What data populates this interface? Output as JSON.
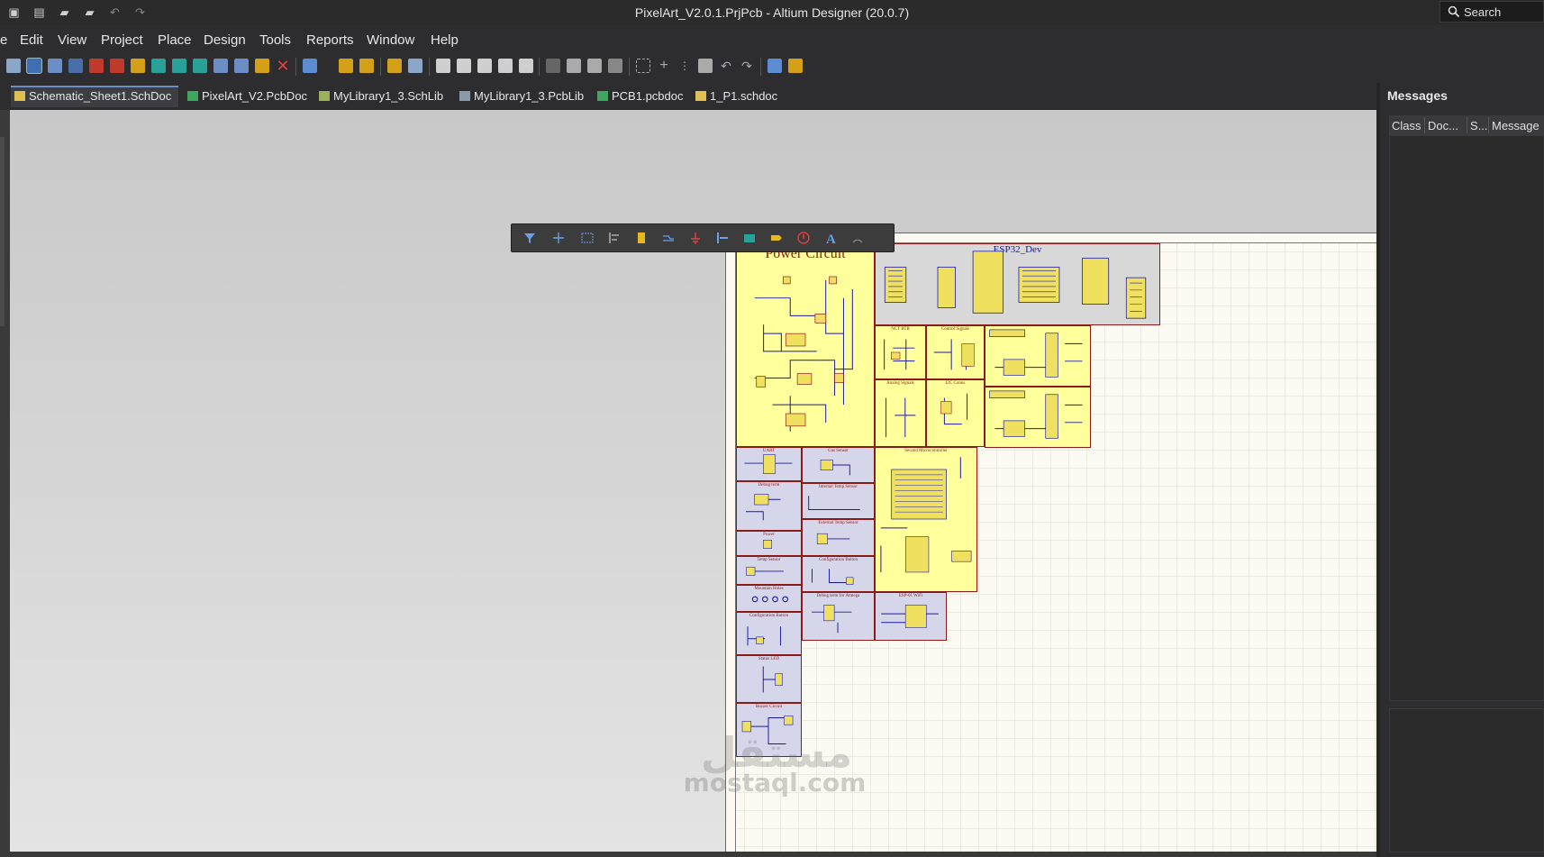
{
  "window": {
    "title": "PixelArt_V2.0.1.PrjPcb - Altium Designer (20.0.7)",
    "search_label": "Search"
  },
  "menu": {
    "items": [
      {
        "label": "e"
      },
      {
        "label": "Edit"
      },
      {
        "label": "View"
      },
      {
        "label": "Project"
      },
      {
        "label": "Place"
      },
      {
        "label": "Design"
      },
      {
        "label": "Tools"
      },
      {
        "label": "Reports"
      },
      {
        "label": "Window"
      },
      {
        "label": "Help"
      }
    ]
  },
  "tabs": [
    {
      "label": "Schematic_Sheet1.SchDoc",
      "icon": "schdoc-icon",
      "active": true
    },
    {
      "label": "PixelArt_V2.PcbDoc",
      "icon": "pcbdoc-icon"
    },
    {
      "label": "MyLibrary1_3.SchLib",
      "icon": "schlib-icon"
    },
    {
      "label": "MyLibrary1_3.PcbLib",
      "icon": "pcblib-icon"
    },
    {
      "label": "PCB1.pcbdoc",
      "icon": "pcbdoc-icon"
    },
    {
      "label": "1_P1.schdoc",
      "icon": "folder-icon"
    }
  ],
  "messages_panel": {
    "title": "Messages",
    "columns": [
      "Class",
      "Doc...",
      "S...",
      "Message"
    ]
  },
  "schematic": {
    "sheets": [
      {
        "id": "power",
        "title": "Power Circuit"
      },
      {
        "id": "esp32",
        "title": "ESP32_Dev"
      },
      {
        "id": "nct",
        "title": "NCT RTR"
      },
      {
        "id": "control",
        "title": "Control Signals"
      },
      {
        "id": "analog",
        "title": "Analog Signals"
      },
      {
        "id": "i2c",
        "title": "I2C Conns"
      },
      {
        "id": "uart",
        "title": "UART"
      },
      {
        "id": "gas",
        "title": "Gas Sensor"
      },
      {
        "id": "debug",
        "title": "Debug term"
      },
      {
        "id": "internal_temp",
        "title": "Internal Temp Sensor"
      },
      {
        "id": "second_mcu",
        "title": "Second Microcontroller"
      },
      {
        "id": "power_small",
        "title": "Power"
      },
      {
        "id": "external_temp",
        "title": "External Temp Sensor"
      },
      {
        "id": "temp",
        "title": "Temp Sensor"
      },
      {
        "id": "config_btn",
        "title": "Configuration Button"
      },
      {
        "id": "mounting",
        "title": "Mountain Holes"
      },
      {
        "id": "debug_atmega",
        "title": "Debug term for Atmega"
      },
      {
        "id": "esp01",
        "title": "ESP-01 WiFi"
      },
      {
        "id": "config_btn2",
        "title": "Configuration Button"
      },
      {
        "id": "status_led",
        "title": "Status LED"
      },
      {
        "id": "buzzer",
        "title": "Buzzer Circuit"
      }
    ]
  },
  "watermark": {
    "arabic": "مستقل",
    "latin": "mostaql.com"
  },
  "colors": {
    "accent": "#6b8fc4",
    "sheet_border": "#8b1a1a",
    "symbol_yellow": "#ffff9c"
  }
}
